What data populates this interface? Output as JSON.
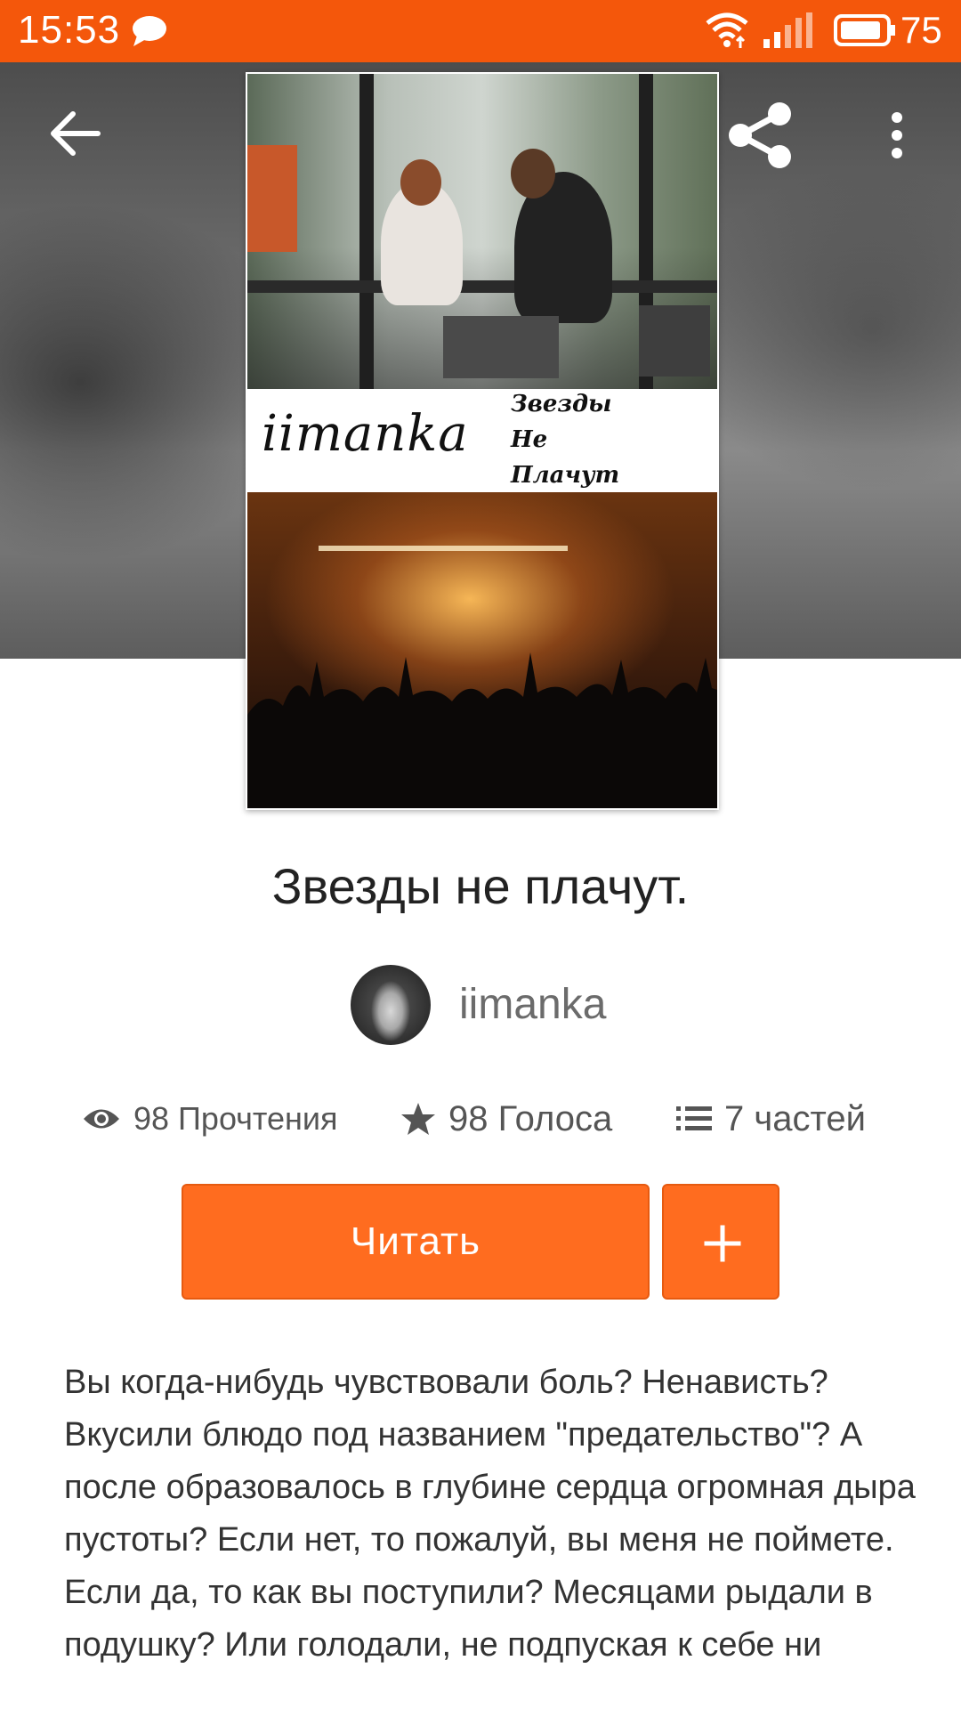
{
  "status_bar": {
    "time": "15:53",
    "battery": "75",
    "icons": [
      "chat-icon",
      "wifi-icon",
      "signal-icon",
      "battery-icon"
    ]
  },
  "toolbar": {
    "icons": [
      "back-arrow-icon",
      "share-icon",
      "more-vert-icon"
    ]
  },
  "cover": {
    "author": "iimanka",
    "script_lines": [
      "Звезды",
      "Не",
      "Плачут"
    ]
  },
  "book": {
    "title": "Звезды не плачут.",
    "author": "iimanka",
    "stats": {
      "reads": "98 Прочтения",
      "votes": "98 Голоса",
      "parts": "7 частей"
    },
    "read_label": "Читать",
    "add_label": "+",
    "description": "Вы когда-нибудь чувствовали боль? Ненависть? Вкусили блюдо под названием \"предательство\"? А после образовалось в глубине сердца огромная дыра пустоты? Если нет, то пожалуй, вы меня не поймете. Если да, то как вы поступили? Месяцами рыдали в подушку? Или голодали, не подпуская к себе ни"
  },
  "colors": {
    "accent": "#f4570b",
    "button": "#ff6c1f",
    "text_primary": "#222222",
    "text_secondary": "#555555"
  }
}
